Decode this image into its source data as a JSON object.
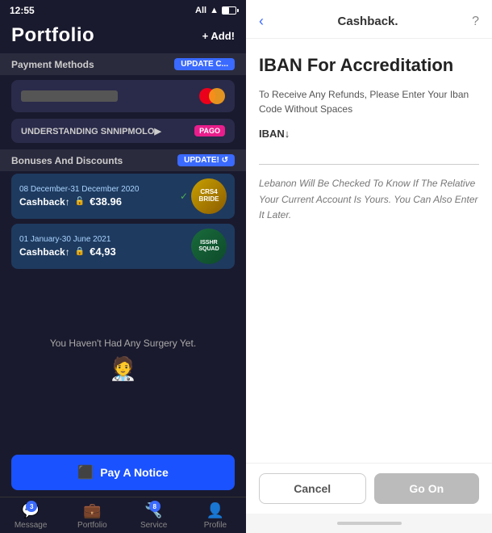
{
  "left": {
    "statusBar": {
      "time": "12:55",
      "network": "All",
      "wifi": "wifi",
      "battery": "battery"
    },
    "portfolioTitle": "Portfolio",
    "addButton": "+ Add!",
    "helpIcon": "?",
    "paymentMethods": {
      "label": "Payment Methods",
      "updateBtn": "UPDATE C..."
    },
    "pagRow": {
      "text": "UNDERSTANDING SNNIPMOLO▶",
      "badge": "PAGO"
    },
    "bonuses": {
      "label": "Bonuses And Discounts",
      "updateBtn": "UPDATE! ↺"
    },
    "cashbacks": [
      {
        "date": "08 December-31 December 2020",
        "label": "Cashback↑",
        "lockIcon": "🔓",
        "amount": "€38.96",
        "badgeLines": [
          "CRS4",
          "BRIDE"
        ],
        "checkmark": "✓"
      },
      {
        "date": "01 January-30 June 2021",
        "label": "Cashback↑",
        "lockIcon": "🔒",
        "amount": "€4,93",
        "badgeLines": [
          "ISSHR",
          "SQUAD"
        ]
      }
    ],
    "noSurgery": "You Haven't Had Any Surgery Yet.",
    "payNotice": "Pay A Notice",
    "nav": [
      {
        "label": "Message",
        "icon": "💬",
        "badge": "3"
      },
      {
        "label": "Portfolio",
        "icon": "💼",
        "badge": null
      },
      {
        "label": "Service",
        "icon": "🔧",
        "badge": "8"
      },
      {
        "label": "Profile",
        "icon": "👤",
        "badge": null
      }
    ]
  },
  "right": {
    "header": {
      "backIcon": "‹",
      "title": "Cashback.",
      "helpIcon": "?"
    },
    "mainTitle": "IBAN For Accreditation",
    "subtitle": "To Receive Any Refunds, Please Enter Your Iban Code Without Spaces",
    "ibanLabel": "IBAN↓",
    "ibanPlaceholder": "",
    "note": "Lebanon Will Be Checked To Know If The Relative Your Current Account Is Yours. You Can Also Enter It Later.",
    "cancelBtn": "Cancel",
    "goOnBtn": "Go On"
  }
}
